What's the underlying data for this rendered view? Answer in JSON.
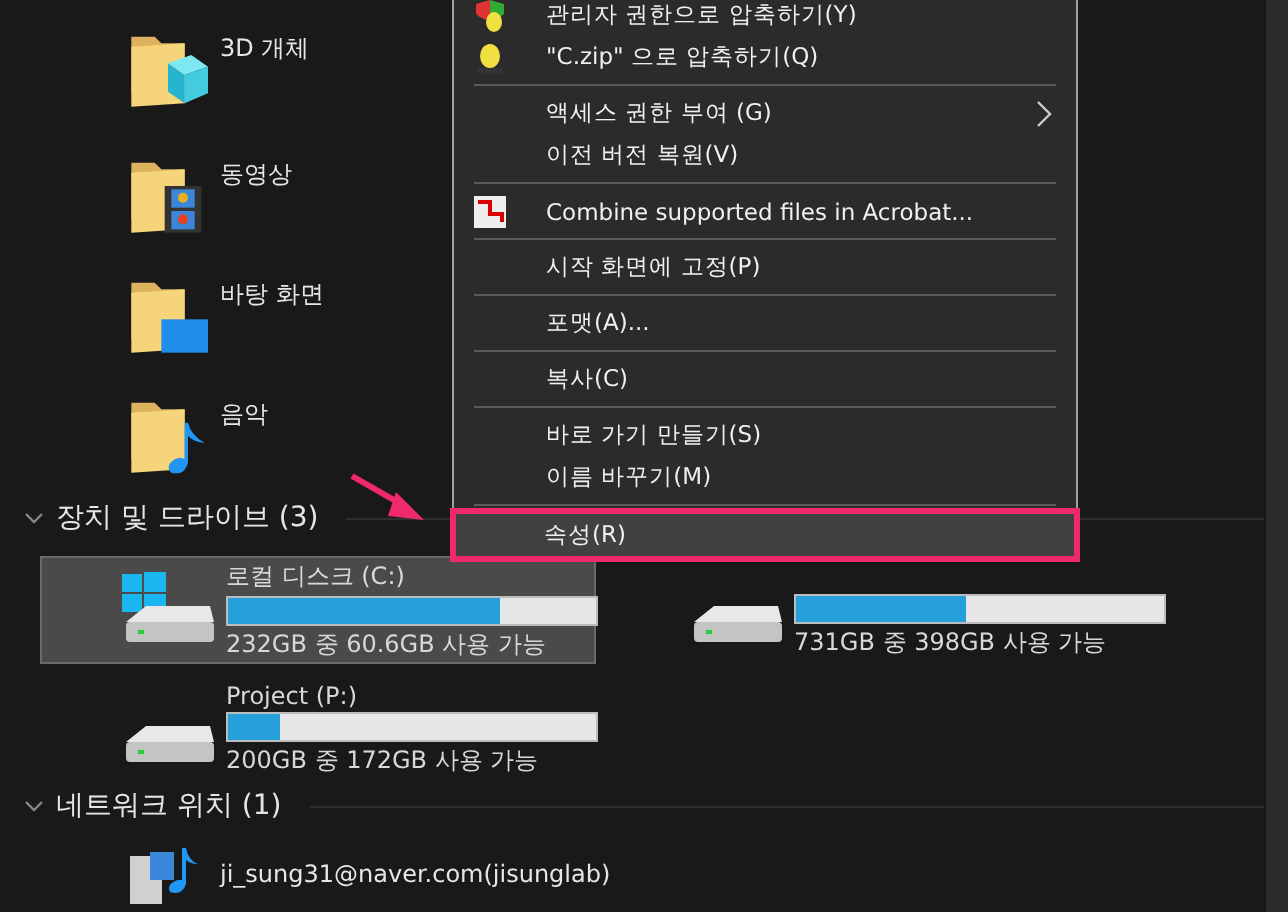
{
  "folders": [
    {
      "name": "3D 개체",
      "kind": "objects3d"
    },
    {
      "name": "동영상",
      "kind": "videos"
    },
    {
      "name": "바탕 화면",
      "kind": "desktop"
    },
    {
      "name": "음악",
      "kind": "music"
    }
  ],
  "drives_section": {
    "title": "장치 및 드라이브 (3)",
    "expanded": true,
    "drives": [
      {
        "name": "로컬 디스크 (C:)",
        "level": 0.74,
        "free": "232GB 중 60.6GB 사용 가능",
        "system": true,
        "selected": true
      },
      {
        "level": 0.46,
        "free": "731GB 중 398GB 사용 가능",
        "system": false,
        "selected": false
      },
      {
        "name": "Project (P:)",
        "level": 0.14,
        "free": "200GB 중 172GB 사용 가능",
        "system": false,
        "selected": false
      }
    ]
  },
  "network_section": {
    "title": "네트워크 위치 (1)",
    "expanded": true,
    "items": [
      {
        "name": "ji_sung31@naver.com(jisunglab)"
      }
    ]
  },
  "context_menu": {
    "items": [
      {
        "kind": "admin-archive",
        "label": "관리자 권한으로 압축하기(Y)",
        "submenu": false,
        "selected": false,
        "annotated": false
      },
      {
        "kind": "archive",
        "label": "\"C.zip\" 으로 압축하기(Q)",
        "submenu": false,
        "selected": false,
        "annotated": false
      },
      {
        "kind": "separator"
      },
      {
        "kind": "item",
        "label": "액세스 권한 부여 (G)",
        "submenu": true,
        "selected": false,
        "annotated": false
      },
      {
        "kind": "item",
        "label": "이전 버전 복원(V)",
        "submenu": false,
        "selected": false,
        "annotated": false
      },
      {
        "kind": "separator"
      },
      {
        "kind": "acrobat",
        "label": "Combine supported files in Acrobat...",
        "submenu": false,
        "selected": false,
        "annotated": false
      },
      {
        "kind": "separator"
      },
      {
        "kind": "item",
        "label": "시작 화면에 고정(P)",
        "submenu": false,
        "selected": false,
        "annotated": false
      },
      {
        "kind": "separator"
      },
      {
        "kind": "item",
        "label": "포맷(A)...",
        "submenu": false,
        "selected": false,
        "annotated": false
      },
      {
        "kind": "separator"
      },
      {
        "kind": "item",
        "label": "복사(C)",
        "submenu": false,
        "selected": false,
        "annotated": false
      },
      {
        "kind": "separator"
      },
      {
        "kind": "item",
        "label": "바로 가기 만들기(S)",
        "submenu": false,
        "selected": false,
        "annotated": false
      },
      {
        "kind": "item",
        "label": "이름 바꾸기(M)",
        "submenu": false,
        "selected": false,
        "annotated": false
      },
      {
        "kind": "separator"
      },
      {
        "kind": "item",
        "label": "속성(R)",
        "submenu": false,
        "selected": true,
        "annotated": true
      }
    ]
  }
}
